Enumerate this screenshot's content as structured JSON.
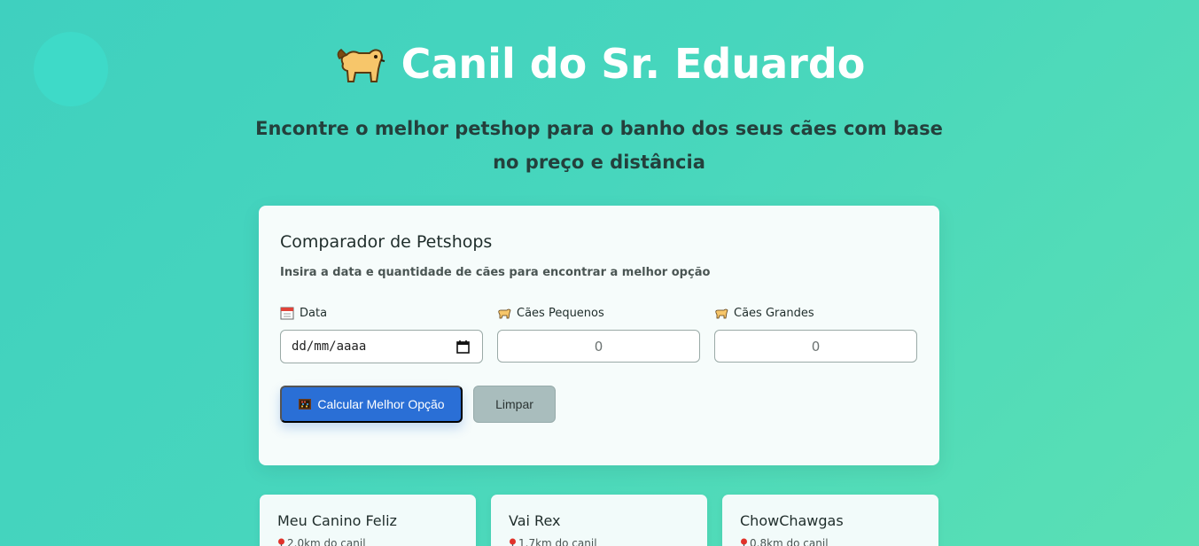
{
  "header": {
    "logo_icon": "dog-emoji-icon",
    "title": "Canil do Sr. Eduardo",
    "subtitle": "Encontre o melhor petshop para o banho dos seus cães com base no preço e distância"
  },
  "form": {
    "title": "Comparador de Petshops",
    "description": "Insira a data e quantidade de cães para encontrar a melhor opção",
    "date_field": {
      "icon": "calendar-icon",
      "label": "Data",
      "placeholder": "dd/mm/aaaa"
    },
    "small_dogs_field": {
      "icon": "dog-icon",
      "label": "Cães Pequenos",
      "placeholder": "0"
    },
    "big_dogs_field": {
      "icon": "dog-icon",
      "label": "Cães Grandes",
      "placeholder": "0"
    },
    "calculate_button": {
      "icon": "abacus-icon",
      "label": "Calcular Melhor Opção"
    },
    "clear_button": {
      "label": "Limpar"
    }
  },
  "petshops": [
    {
      "name": "Meu Canino Feliz",
      "distance": "2.0km do canil",
      "icon": "pin-icon"
    },
    {
      "name": "Vai Rex",
      "distance": "1.7km do canil",
      "icon": "pin-icon"
    },
    {
      "name": "ChowChawgas",
      "distance": "0.8km do canil",
      "icon": "pin-icon"
    }
  ],
  "colors": {
    "background_start": "#3fd0bf",
    "background_end": "#5ae0b4",
    "primary_button": "#2a6fd6",
    "secondary_button": "#a9bdbd"
  }
}
